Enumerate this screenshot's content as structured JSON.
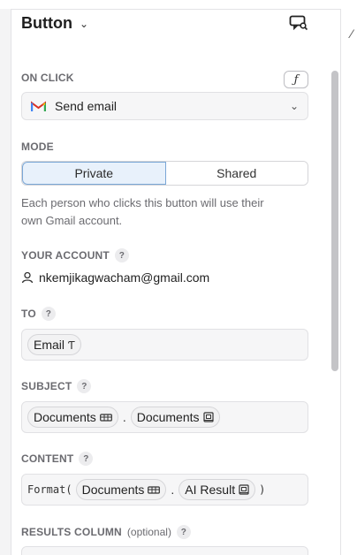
{
  "header": {
    "title": "Button"
  },
  "on_click": {
    "label": "ON CLICK",
    "fx_label": "ƒ",
    "action": "Send email"
  },
  "mode": {
    "label": "MODE",
    "options": [
      "Private",
      "Shared"
    ],
    "selected": "Private",
    "description": "Each person who clicks this button will use their own Gmail account."
  },
  "account": {
    "label": "YOUR ACCOUNT",
    "email": "nkemjikagwacham@gmail.com"
  },
  "to": {
    "label": "TO",
    "chip": "Email",
    "chip_icon": "Ƭ"
  },
  "subject": {
    "label": "SUBJECT",
    "chips": [
      "Documents",
      "Documents"
    ],
    "separator": "."
  },
  "content": {
    "label": "CONTENT",
    "prefix": "Format(",
    "chips": [
      "Documents",
      "AI Result"
    ],
    "separator": ".",
    "suffix": ")"
  },
  "results_column": {
    "label": "RESULTS COLUMN",
    "optional": "(optional)"
  },
  "help_glyph": "?",
  "colors": {
    "accent": "#7aa7d6",
    "selected_bg": "#e8f1fb"
  }
}
